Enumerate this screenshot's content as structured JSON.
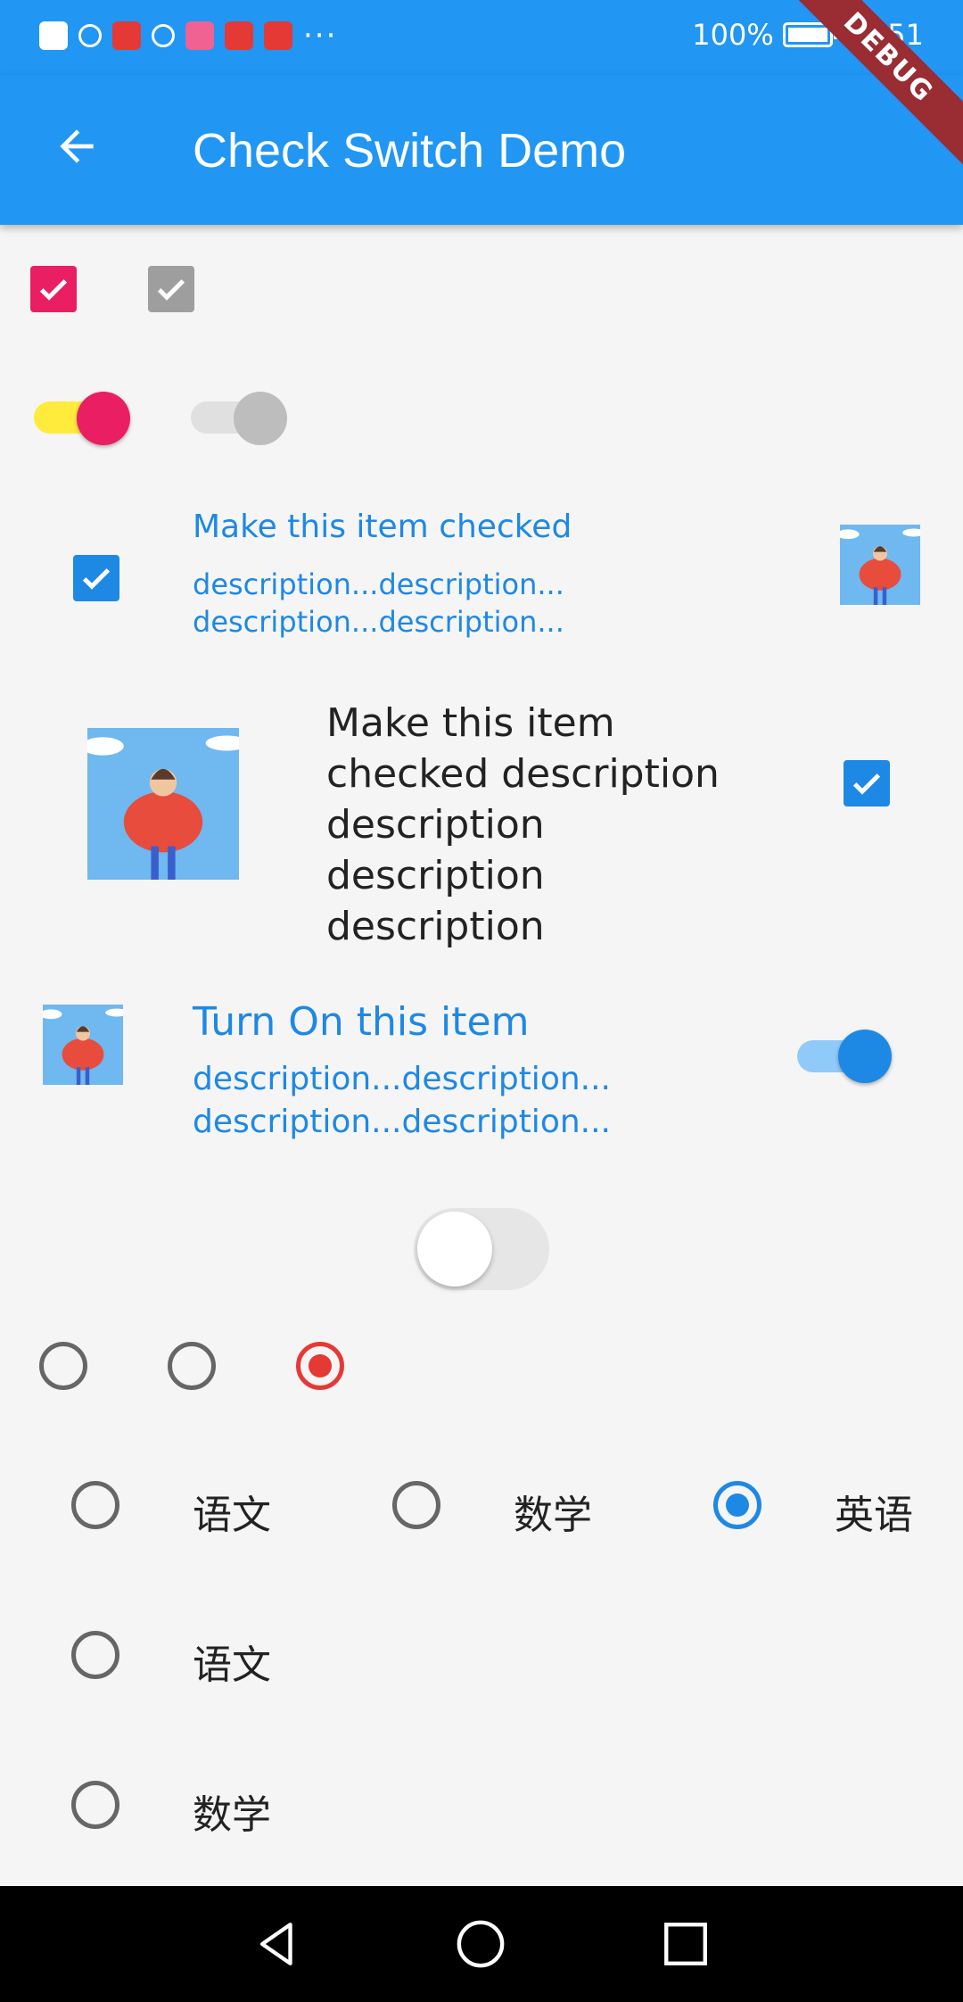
{
  "status_bar": {
    "battery": "100%",
    "time": "23:51"
  },
  "app_bar": {
    "title": "Check Switch Demo"
  },
  "debug_banner": "DEBUG",
  "colors": {
    "primary": "#2196f3",
    "accent_pink": "#e91e63",
    "yellow": "#ffeb3b",
    "blue_text": "#1e88e5",
    "radio_red": "#e53935"
  },
  "checkbox_row": [
    {
      "checked": true,
      "color": "#e91e63"
    },
    {
      "checked": true,
      "color": "#9e9e9e",
      "disabled": true
    }
  ],
  "switch_row": [
    {
      "on": true,
      "track_color": "#ffeb3b",
      "thumb_color": "#e91e63"
    },
    {
      "on": true,
      "disabled": true
    }
  ],
  "checkbox_tile_1": {
    "title": "Make this item checked",
    "subtitle": "description...description...\ndescription...description...",
    "checked": true,
    "secondary_icon": "person-illustration"
  },
  "checkbox_tile_2": {
    "title": "Make this item checked description description description description",
    "checked": true,
    "leading_icon": "person-illustration"
  },
  "switch_tile": {
    "title": "Turn On this item",
    "subtitle": "description...description...\ndescription...description...",
    "on": true,
    "leading_icon": "person-illustration"
  },
  "cupertino_switch": {
    "on": false
  },
  "radio_row": [
    {
      "selected": false
    },
    {
      "selected": false
    },
    {
      "selected": true,
      "color": "#e53935"
    }
  ],
  "radio_tiles_row": [
    {
      "label": "语文",
      "selected": false
    },
    {
      "label": "数学",
      "selected": false
    },
    {
      "label": "英语",
      "selected": true
    }
  ],
  "radio_tiles_column": [
    {
      "label": "语文",
      "selected": false
    },
    {
      "label": "数学",
      "selected": false
    }
  ],
  "nav_bar": [
    "back-icon",
    "home-icon",
    "recents-icon"
  ]
}
